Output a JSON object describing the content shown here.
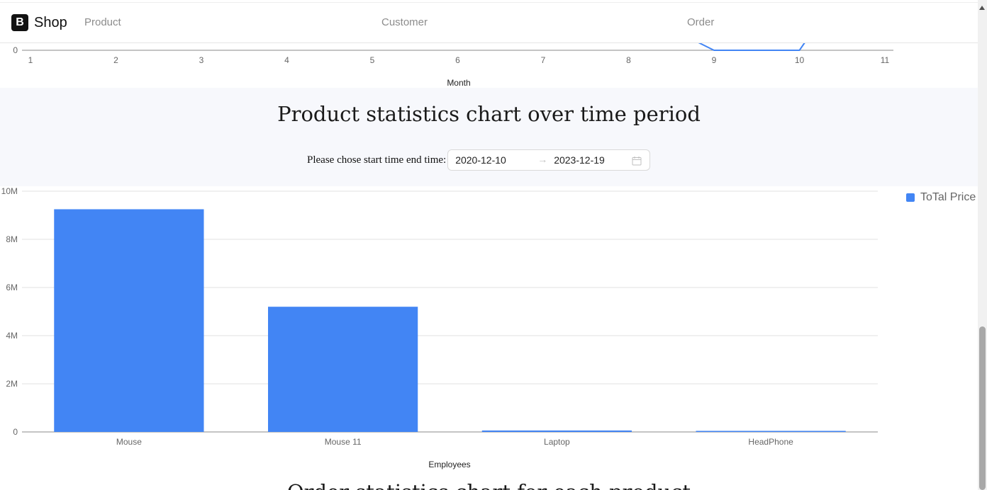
{
  "navbar": {
    "brand_logo": "B",
    "brand_name": "Shop",
    "links": [
      "Product",
      "Customer",
      "Order"
    ]
  },
  "line_chart_partial": {
    "type": "line",
    "x": [
      1,
      2,
      3,
      4,
      5,
      6,
      7,
      8,
      9,
      10,
      11
    ],
    "xlabel": "Month",
    "visible_y_tick": "0",
    "series": [
      {
        "color": "#4285f4",
        "visible_points": [
          [
            9,
            0
          ],
          [
            10,
            0
          ]
        ]
      }
    ]
  },
  "stats": {
    "title": "Product statistics chart over time period",
    "range_label": "Please chose start time end time:",
    "start_date": "2020-12-10",
    "end_date": "2023-12-19",
    "separator": "→"
  },
  "chart_data": {
    "type": "bar",
    "categories": [
      "Mouse",
      "Mouse 11",
      "Laptop",
      "HeadPhone"
    ],
    "series": [
      {
        "name": "ToTal Price",
        "values": [
          9250000,
          5200000,
          60000,
          30000
        ],
        "color": "#4285f4"
      }
    ],
    "xlabel": "Employees",
    "ylabel": "",
    "ylim": [
      0,
      10000000
    ],
    "yticks": [
      0,
      2000000,
      4000000,
      6000000,
      8000000,
      10000000
    ],
    "ytick_labels": [
      "0",
      "2M",
      "4M",
      "6M",
      "8M",
      "10M"
    ],
    "grid": true,
    "legend": "top-right"
  },
  "next_section": {
    "title": "Order statistics chart for each product"
  },
  "colors": {
    "bar": "#4285f4",
    "gridline": "#e0e0e0",
    "axis_text": "#666666"
  }
}
